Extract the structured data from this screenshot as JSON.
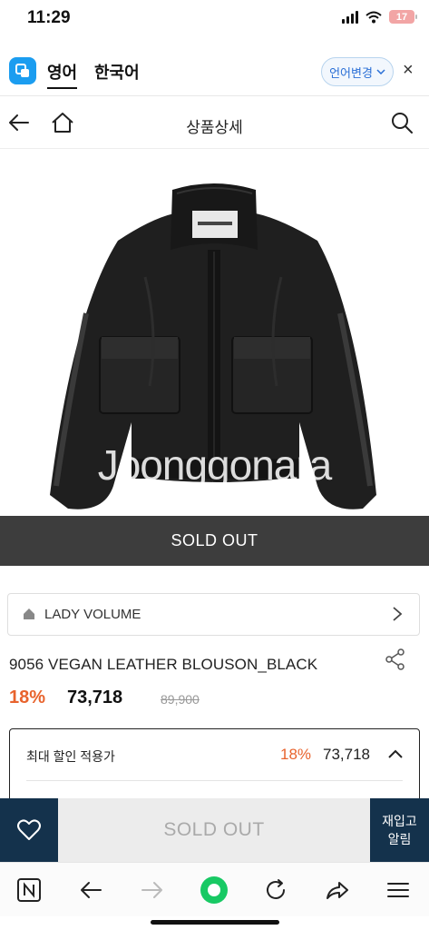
{
  "status_bar": {
    "time": "11:29",
    "battery": "17"
  },
  "translate_bar": {
    "source_lang": "영어",
    "target_lang": "한국어",
    "change_button": "언어변경",
    "close_symbol": "×"
  },
  "header": {
    "title": "상품상세",
    "icons": [
      "back-arrow-icon",
      "home-icon",
      "search-icon"
    ]
  },
  "product": {
    "image_desc_icon": "leather-jacket-image",
    "watermark": "Joonggonara",
    "sold_out_banner": "SOLD OUT",
    "brand": "LADY VOLUME",
    "name": "9056 VEGAN LEATHER BLOUSON_BLACK",
    "discount_rate": "18%",
    "sale_price": "73,718",
    "original_price": "89,900"
  },
  "max_discount": {
    "label": "최대 할인 적용가",
    "rate": "18%",
    "price": "73,718"
  },
  "bottom_actions": {
    "sold_out_label": "SOLD OUT",
    "restock_line1": "재입고",
    "restock_line2": "알림"
  },
  "browser_nav": {
    "icons": [
      "n-tab-icon",
      "back-icon",
      "forward-icon",
      "green-dot-icon",
      "reload-icon",
      "share-icon",
      "menu-icon"
    ]
  },
  "colors": {
    "accent_orange": "#e8632d",
    "navy": "#14324c",
    "banner_dark": "#3d3d3d",
    "translate_blue": "#1b9df0"
  }
}
